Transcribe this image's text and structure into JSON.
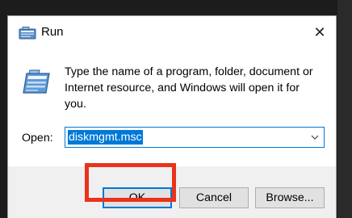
{
  "window": {
    "title": "Run",
    "icon": "run-app-icon",
    "close_glyph": "✕"
  },
  "content": {
    "icon": "run-dialog-icon",
    "description": "Type the name of a program, folder, document or Internet resource, and Windows will open it for you.",
    "open_label": "Open:",
    "open_value": "diskmgmt.msc",
    "dropdown_icon": "chevron-down-icon"
  },
  "buttons": {
    "ok_label": "OK",
    "cancel_label": "Cancel",
    "browse_label": "Browse..."
  },
  "colors": {
    "accent": "#0078d7",
    "highlight": "#e8331d",
    "dialog_bg": "#f0f0f0",
    "content_bg": "#ffffff"
  }
}
